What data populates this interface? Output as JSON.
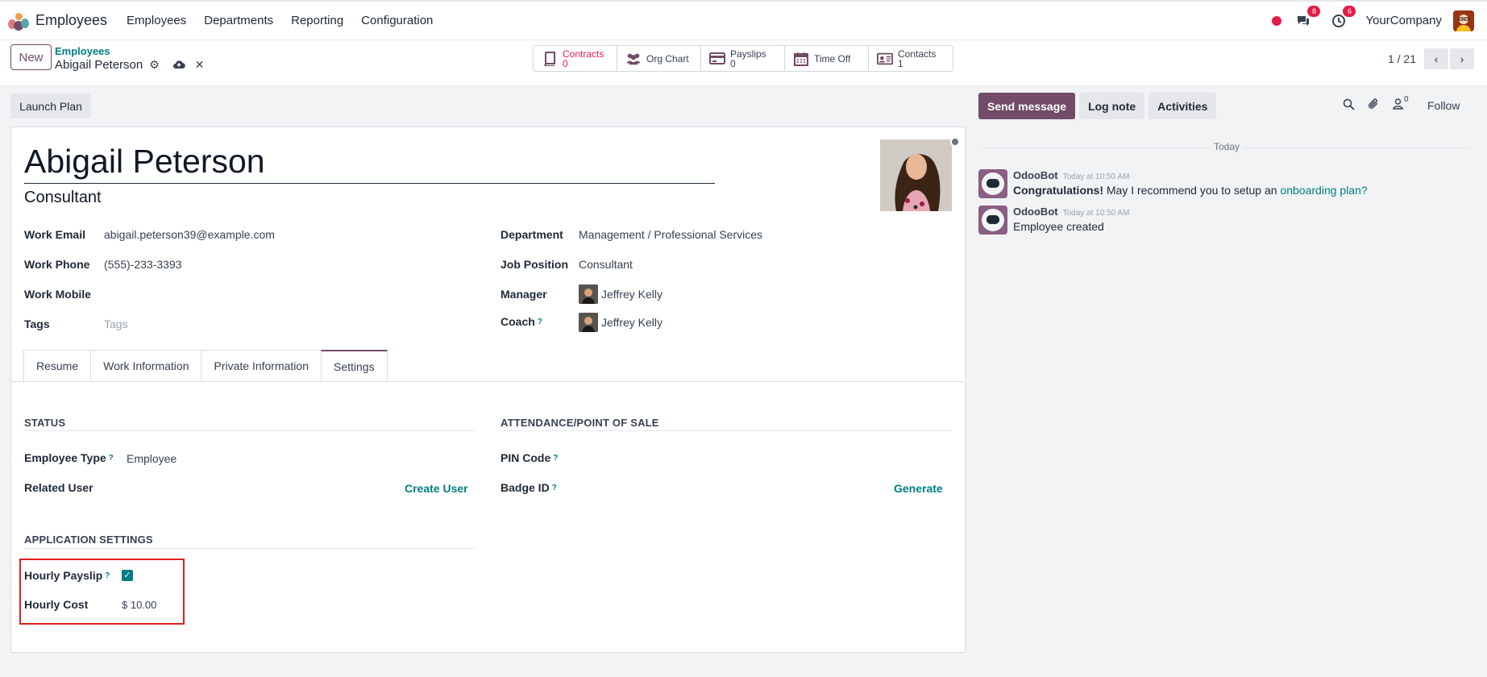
{
  "navbar": {
    "app_title": "Employees",
    "menu": [
      "Employees",
      "Departments",
      "Reporting",
      "Configuration"
    ],
    "messages_badge": "8",
    "activities_badge": "6",
    "company": "YourCompany"
  },
  "control": {
    "new_label": "New",
    "breadcrumb_parent": "Employees",
    "breadcrumb_current": "Abigail Peterson",
    "stats": {
      "contracts": {
        "label": "Contracts",
        "count": "0"
      },
      "org_chart": {
        "label": "Org Chart"
      },
      "payslips": {
        "label": "Payslips",
        "count": "0"
      },
      "time_off": {
        "label": "Time Off"
      },
      "contacts": {
        "label": "Contacts",
        "count": "1"
      }
    },
    "pager": "1 / 21"
  },
  "form": {
    "launch_plan": "Launch Plan",
    "name": "Abigail Peterson",
    "job_title": "Consultant",
    "fields": {
      "work_email": {
        "label": "Work Email",
        "value": "abigail.peterson39@example.com"
      },
      "work_phone": {
        "label": "Work Phone",
        "value": "(555)-233-3393"
      },
      "work_mobile": {
        "label": "Work Mobile",
        "value": ""
      },
      "tags": {
        "label": "Tags",
        "placeholder": "Tags"
      },
      "department": {
        "label": "Department",
        "value": "Management / Professional Services"
      },
      "job_position": {
        "label": "Job Position",
        "value": "Consultant"
      },
      "manager": {
        "label": "Manager",
        "value": "Jeffrey Kelly"
      },
      "coach": {
        "label": "Coach",
        "value": "Jeffrey Kelly",
        "help": "?"
      }
    },
    "tabs": [
      "Resume",
      "Work Information",
      "Private Information",
      "Settings"
    ],
    "active_tab": "Settings",
    "settings": {
      "status_title": "STATUS",
      "employee_type": {
        "label": "Employee Type",
        "value": "Employee",
        "help": "?"
      },
      "related_user": {
        "label": "Related User",
        "action": "Create User"
      },
      "attendance_title": "ATTENDANCE/POINT OF SALE",
      "pin_code": {
        "label": "PIN Code",
        "help": "?"
      },
      "badge_id": {
        "label": "Badge ID",
        "action": "Generate",
        "help": "?"
      },
      "app_settings_title": "APPLICATION SETTINGS",
      "hourly_payslip": {
        "label": "Hourly Payslip",
        "checked": true,
        "help": "?"
      },
      "hourly_cost": {
        "label": "Hourly Cost",
        "value": "$ 10.00"
      }
    }
  },
  "chatter": {
    "send_message": "Send message",
    "log_note": "Log note",
    "activities": "Activities",
    "followers_count": "0",
    "follow": "Follow",
    "day_separator": "Today",
    "messages": [
      {
        "author": "OdooBot",
        "time": "Today at 10:50 AM",
        "bold": "Congratulations!",
        "text": " May I recommend you to setup an ",
        "link": "onboarding plan?"
      },
      {
        "author": "OdooBot",
        "time": "Today at 10:50 AM",
        "text": "Employee created"
      }
    ]
  }
}
